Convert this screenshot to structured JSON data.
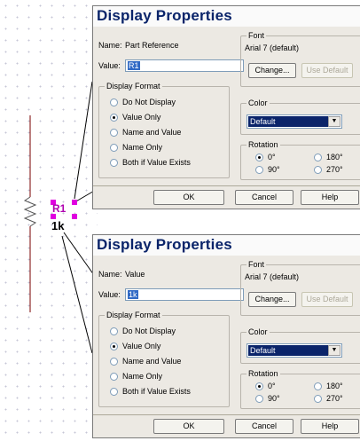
{
  "schematic": {
    "ref_designator": "R1",
    "value_label": "1k"
  },
  "dialogs": [
    {
      "title": "Display Properties",
      "name_label": "Name:",
      "name_value": "Part Reference",
      "value_label": "Value:",
      "value_text": "R1",
      "display_format": {
        "title": "Display Format",
        "options": [
          "Do Not Display",
          "Value Only",
          "Name and Value",
          "Name Only",
          "Both if Value Exists"
        ],
        "selected": "Value Only"
      },
      "font": {
        "title": "Font",
        "current": "Arial 7 (default)",
        "change_label": "Change...",
        "default_label": "Use Default"
      },
      "color": {
        "title": "Color",
        "selected": "Default"
      },
      "rotation": {
        "title": "Rotation",
        "options": [
          "0°",
          "180°",
          "90°",
          "270°"
        ],
        "selected": "0°"
      },
      "buttons": {
        "ok": "OK",
        "cancel": "Cancel",
        "help": "Help"
      },
      "close_icon": "close-icon"
    },
    {
      "title": "Display Properties",
      "name_label": "Name:",
      "name_value": "Value",
      "value_label": "Value:",
      "value_text": "1k",
      "display_format": {
        "title": "Display Format",
        "options": [
          "Do Not Display",
          "Value Only",
          "Name and Value",
          "Name Only",
          "Both if Value Exists"
        ],
        "selected": "Value Only"
      },
      "font": {
        "title": "Font",
        "current": "Arial 7 (default)",
        "change_label": "Change...",
        "default_label": "Use Default"
      },
      "color": {
        "title": "Color",
        "selected": "Default"
      },
      "rotation": {
        "title": "Rotation",
        "options": [
          "0°",
          "180°",
          "90°",
          "270°"
        ],
        "selected": "0°"
      },
      "buttons": {
        "ok": "OK",
        "cancel": "Cancel",
        "help": "Help"
      },
      "close_icon": "close-icon"
    }
  ],
  "colors": {
    "title_text": "#0a246a",
    "dialog_bg": "#ece9e3",
    "selection": "#316ac5",
    "handle": "#e000e0",
    "refdes": "#b000b0"
  }
}
